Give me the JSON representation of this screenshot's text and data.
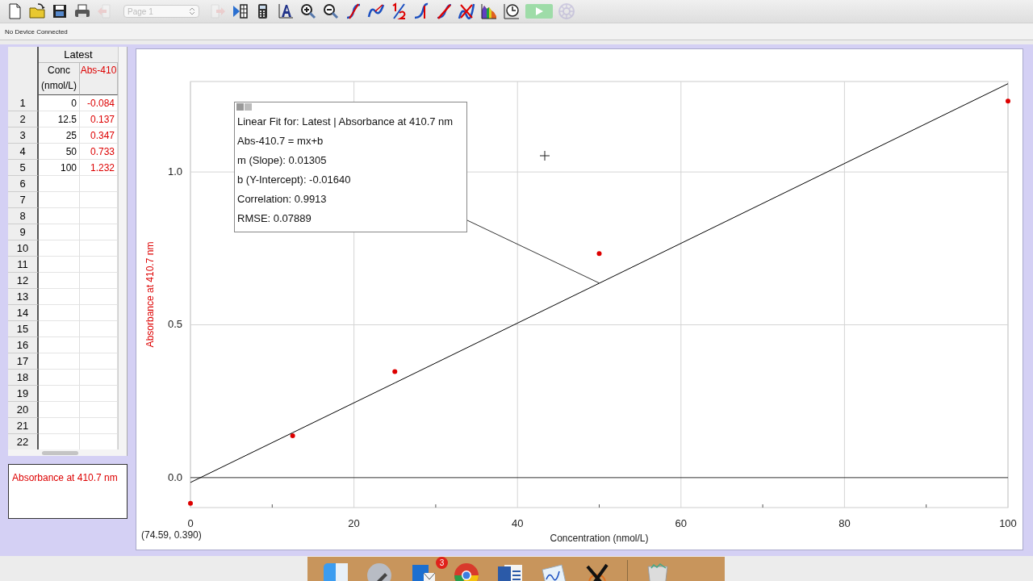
{
  "toolbar": {
    "items": [
      {
        "kind": "new",
        "disabled": false
      },
      {
        "kind": "open",
        "disabled": false
      },
      {
        "kind": "save",
        "disabled": false
      },
      {
        "kind": "print",
        "disabled": false
      },
      {
        "kind": "back",
        "disabled": true
      },
      {
        "kind": "page",
        "disabled": true,
        "value": "Page 1"
      },
      {
        "kind": "forward",
        "disabled": true
      },
      {
        "kind": "step",
        "disabled": false
      },
      {
        "kind": "calculator",
        "disabled": false
      },
      {
        "kind": "label",
        "disabled": false
      },
      {
        "kind": "zoom-in",
        "disabled": false
      },
      {
        "kind": "zoom-out",
        "disabled": false
      },
      {
        "kind": "tangent",
        "disabled": false
      },
      {
        "kind": "curve",
        "disabled": false
      },
      {
        "kind": "half",
        "disabled": false
      },
      {
        "kind": "area",
        "disabled": false
      },
      {
        "kind": "linear",
        "disabled": false
      },
      {
        "kind": "peaks",
        "disabled": false
      },
      {
        "kind": "spectrum",
        "disabled": false
      },
      {
        "kind": "timer",
        "disabled": false
      },
      {
        "kind": "collect",
        "disabled": true
      },
      {
        "kind": "settings",
        "disabled": true
      }
    ]
  },
  "status": "No Device Connected",
  "table": {
    "group": "Latest",
    "columns": [
      {
        "name": "Conc",
        "unit": "(nmol/L)",
        "color": "#000000"
      },
      {
        "name": "Abs-410",
        "color": "#dd0000"
      }
    ],
    "rows": [
      {
        "index": "1",
        "cells": [
          "0",
          "-0.084"
        ]
      },
      {
        "index": "2",
        "cells": [
          "12.5",
          "0.137"
        ]
      },
      {
        "index": "3",
        "cells": [
          "25",
          "0.347"
        ]
      },
      {
        "index": "4",
        "cells": [
          "50",
          "0.733"
        ]
      },
      {
        "index": "5",
        "cells": [
          "100",
          "1.232"
        ]
      },
      {
        "index": "6",
        "cells": [
          "",
          ""
        ]
      },
      {
        "index": "7",
        "cells": [
          "",
          ""
        ]
      },
      {
        "index": "8",
        "cells": [
          "",
          ""
        ]
      },
      {
        "index": "9",
        "cells": [
          "",
          ""
        ]
      },
      {
        "index": "10",
        "cells": [
          "",
          ""
        ]
      },
      {
        "index": "11",
        "cells": [
          "",
          ""
        ]
      },
      {
        "index": "12",
        "cells": [
          "",
          ""
        ]
      },
      {
        "index": "13",
        "cells": [
          "",
          ""
        ]
      },
      {
        "index": "14",
        "cells": [
          "",
          ""
        ]
      },
      {
        "index": "15",
        "cells": [
          "",
          ""
        ]
      },
      {
        "index": "16",
        "cells": [
          "",
          ""
        ]
      },
      {
        "index": "17",
        "cells": [
          "",
          ""
        ]
      },
      {
        "index": "18",
        "cells": [
          "",
          ""
        ]
      },
      {
        "index": "19",
        "cells": [
          "",
          ""
        ]
      },
      {
        "index": "20",
        "cells": [
          "",
          ""
        ]
      },
      {
        "index": "21",
        "cells": [
          "",
          ""
        ]
      },
      {
        "index": "22",
        "cells": [
          "",
          ""
        ]
      }
    ]
  },
  "legend": {
    "text": "Absorbance at 410.7 nm",
    "color": "#dd0000"
  },
  "graph": {
    "chart_data": {
      "type": "scatter",
      "xlabel": "Concentration (nmol/L)",
      "ylabel": "Absorbance at 410.7 nm",
      "x": [
        0,
        12.5,
        25,
        50,
        100
      ],
      "series": [
        {
          "color": "#dd0000",
          "values": [
            -0.084,
            0.137,
            0.347,
            0.733,
            1.232
          ]
        },
        {
          "color": "#000000",
          "type": "line",
          "values": [
            -0.016,
            0.147,
            0.31,
            0.636,
            1.289
          ]
        }
      ],
      "grid": true,
      "xlim": [
        0,
        100
      ],
      "ylim": [
        -0.098,
        1.296
      ],
      "xticks": [
        0,
        20,
        40,
        60,
        80,
        100
      ],
      "yticks": [
        {
          "value": 0,
          "label": "0.0"
        },
        {
          "value": 0.5,
          "label": "0.5"
        },
        {
          "value": 1,
          "label": "1.0"
        }
      ]
    },
    "fit_box": {
      "lines": [
        "Linear Fit for: Latest | Absorbance at 410.7 nm",
        "Abs-410.7 = mx+b",
        "m (Slope): 0.01305",
        "b (Y-Intercept): -0.01640",
        "Correlation: 0.9913",
        "RMSE: 0.07889"
      ]
    },
    "readout": "(74.59, 0.390)"
  },
  "dock": {
    "items": [
      {
        "kind": "finder"
      },
      {
        "kind": "rocket"
      },
      {
        "kind": "mail",
        "badge": "3"
      },
      {
        "kind": "browser"
      },
      {
        "kind": "word"
      },
      {
        "kind": "grapher"
      },
      {
        "kind": "x-app"
      },
      {
        "kind": "trash"
      }
    ]
  }
}
